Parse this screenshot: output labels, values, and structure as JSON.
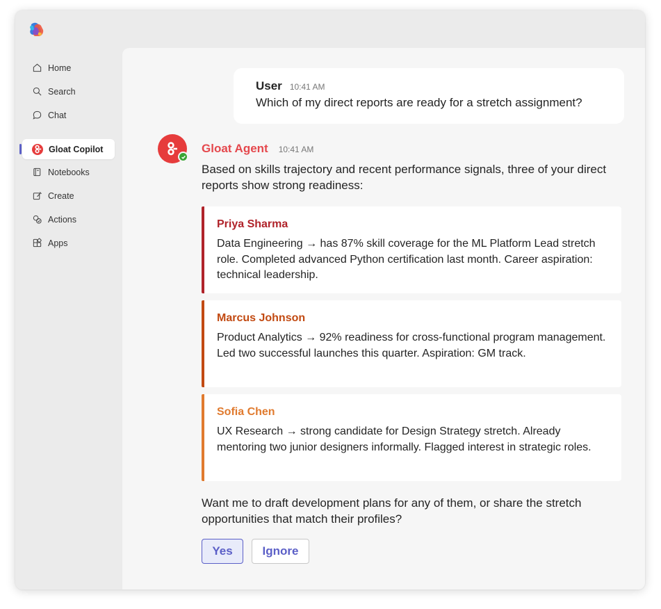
{
  "app": {
    "logo_icon": "copilot-logo-icon"
  },
  "sidebar": {
    "items": [
      {
        "label": "Home",
        "icon": "home-icon"
      },
      {
        "label": "Search",
        "icon": "search-icon"
      },
      {
        "label": "Chat",
        "icon": "chat-icon"
      },
      {
        "label": "Gloat Copilot",
        "icon": "gloat-logo-icon",
        "active": true
      },
      {
        "label": "Notebooks",
        "icon": "notebook-icon"
      },
      {
        "label": "Create",
        "icon": "create-icon"
      },
      {
        "label": "Actions",
        "icon": "actions-icon"
      },
      {
        "label": "Apps",
        "icon": "apps-icon"
      }
    ]
  },
  "conversation": {
    "user_message": {
      "sender": "User",
      "time": "10:41 AM",
      "text": "Which of my direct reports are ready for a stretch assignment?"
    },
    "agent_message": {
      "sender": "Gloat Agent",
      "time": "10:41 AM",
      "intro": "Based on skills trajectory and recent performance signals, three of your direct reports show strong readiness:",
      "candidates": [
        {
          "name": "Priya Sharma",
          "color": "#b0232a",
          "text": "Data Engineering → has 87% skill coverage for the ML Platform Lead stretch role. Completed advanced Python certification last month. Career aspiration: technical leadership."
        },
        {
          "name": "Marcus Johnson",
          "color": "#c24a12",
          "text": "Product Analytics → 92% readiness for cross-functional program management. Led two successful launches this quarter. Aspiration: GM track."
        },
        {
          "name": "Sofia Chen",
          "color": "#e07a2e",
          "text": "UX Research → strong candidate for Design Strategy stretch. Already mentoring two junior designers informally. Flagged interest in strategic roles."
        }
      ],
      "followup": "Want me to draft development plans for any of them, or share the stretch opportunities that match their profiles?",
      "actions": {
        "yes_label": "Yes",
        "ignore_label": "Ignore"
      }
    }
  },
  "colors": {
    "accent": "#5b5fc7",
    "agent_brand": "#e5484d",
    "status_online": "#3aa535"
  }
}
